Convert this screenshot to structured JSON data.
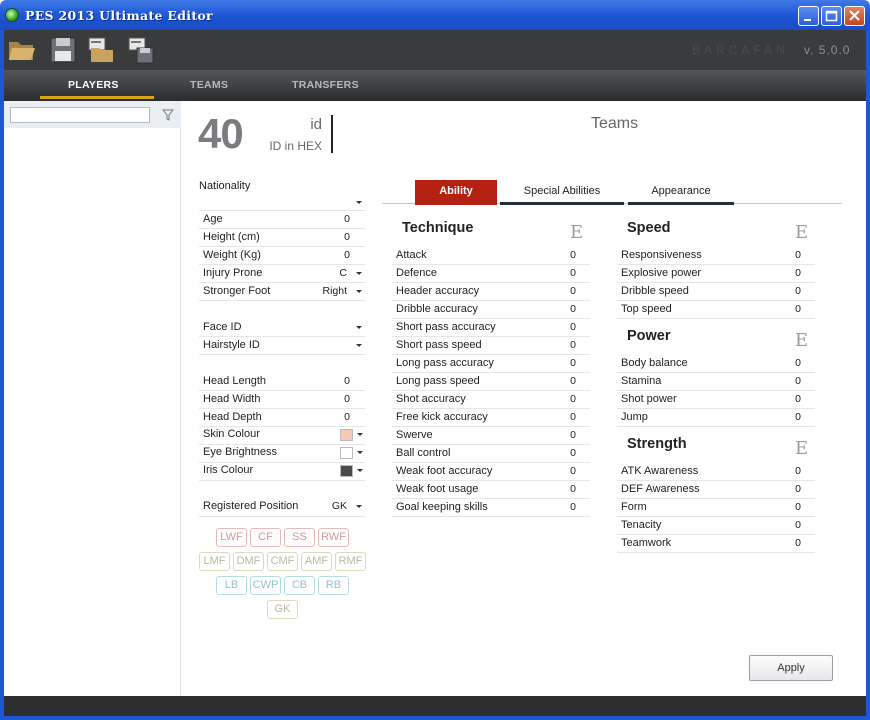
{
  "window": {
    "title": "PES 2013 Ultimate Editor",
    "min": "_",
    "max": "□",
    "close": "✕"
  },
  "toolbar": {
    "brand": "BARCAFAN",
    "version": "v. 5.0.0"
  },
  "nav": {
    "tabs": [
      "PLAYERS",
      "TEAMS",
      "TRANSFERS"
    ],
    "active": 0
  },
  "search": {
    "value": "",
    "placeholder": ""
  },
  "player": {
    "id": "40",
    "id_label": "id",
    "hex_label": "ID in HEX",
    "teams_title": "Teams"
  },
  "fields": {
    "nationality": {
      "label": "Nationality",
      "value": ""
    },
    "age": {
      "label": "Age",
      "value": "0"
    },
    "height": {
      "label": "Height (cm)",
      "value": "0"
    },
    "weight": {
      "label": "Weight (Kg)",
      "value": "0"
    },
    "injury": {
      "label": "Injury Prone",
      "value": "C"
    },
    "foot": {
      "label": "Stronger Foot",
      "value": "Right"
    },
    "face": {
      "label": "Face ID",
      "value": ""
    },
    "hair": {
      "label": "Hairstyle ID",
      "value": ""
    },
    "head_length": {
      "label": "Head Length",
      "value": "0"
    },
    "head_width": {
      "label": "Head Width",
      "value": "0"
    },
    "head_depth": {
      "label": "Head Depth",
      "value": "0"
    },
    "skin": {
      "label": "Skin Colour",
      "color": "#f6c9b6"
    },
    "eye": {
      "label": "Eye Brightness",
      "color": "#ffffff"
    },
    "iris": {
      "label": "Iris Colour",
      "color": "#4a4a4a"
    },
    "reg_pos": {
      "label": "Registered Position",
      "value": "GK"
    }
  },
  "positions": {
    "forwards": [
      "LWF",
      "CF",
      "SS",
      "RWF"
    ],
    "midfield": [
      "LMF",
      "DMF",
      "CMF",
      "AMF",
      "RMF"
    ],
    "defence": [
      "LB",
      "CWP",
      "CB",
      "RB"
    ],
    "keeper": [
      "GK"
    ]
  },
  "tabs": {
    "ability": "Ability",
    "special": "Special Abilities",
    "appearance": "Appearance"
  },
  "technique": {
    "title": "Technique",
    "grade": "E",
    "stats": [
      {
        "label": "Attack",
        "value": "0"
      },
      {
        "label": "Defence",
        "value": "0"
      },
      {
        "label": "Header accuracy",
        "value": "0"
      },
      {
        "label": "Dribble accuracy",
        "value": "0"
      },
      {
        "label": "Short pass accuracy",
        "value": "0"
      },
      {
        "label": "Short pass speed",
        "value": "0"
      },
      {
        "label": "Long pass accuracy",
        "value": "0"
      },
      {
        "label": "Long pass speed",
        "value": "0"
      },
      {
        "label": "Shot accuracy",
        "value": "0"
      },
      {
        "label": "Free kick accuracy",
        "value": "0"
      },
      {
        "label": "Swerve",
        "value": "0"
      },
      {
        "label": "Ball control",
        "value": "0"
      },
      {
        "label": "Weak foot accuracy",
        "value": "0"
      },
      {
        "label": "Weak foot usage",
        "value": "0"
      },
      {
        "label": "Goal keeping skills",
        "value": "0"
      }
    ]
  },
  "speed": {
    "title": "Speed",
    "grade": "E",
    "stats": [
      {
        "label": "Responsiveness",
        "value": "0"
      },
      {
        "label": "Explosive power",
        "value": "0"
      },
      {
        "label": "Dribble speed",
        "value": "0"
      },
      {
        "label": "Top speed",
        "value": "0"
      }
    ]
  },
  "power": {
    "title": "Power",
    "grade": "E",
    "stats": [
      {
        "label": "Body balance",
        "value": "0"
      },
      {
        "label": "Stamina",
        "value": "0"
      },
      {
        "label": "Shot power",
        "value": "0"
      },
      {
        "label": "Jump",
        "value": "0"
      }
    ]
  },
  "strength": {
    "title": "Strength",
    "grade": "E",
    "stats": [
      {
        "label": "ATK Awareness",
        "value": "0"
      },
      {
        "label": "DEF Awareness",
        "value": "0"
      },
      {
        "label": "Form",
        "value": "0"
      },
      {
        "label": "Tenacity",
        "value": "0"
      },
      {
        "label": "Teamwork",
        "value": "0"
      }
    ]
  },
  "apply_label": "Apply"
}
